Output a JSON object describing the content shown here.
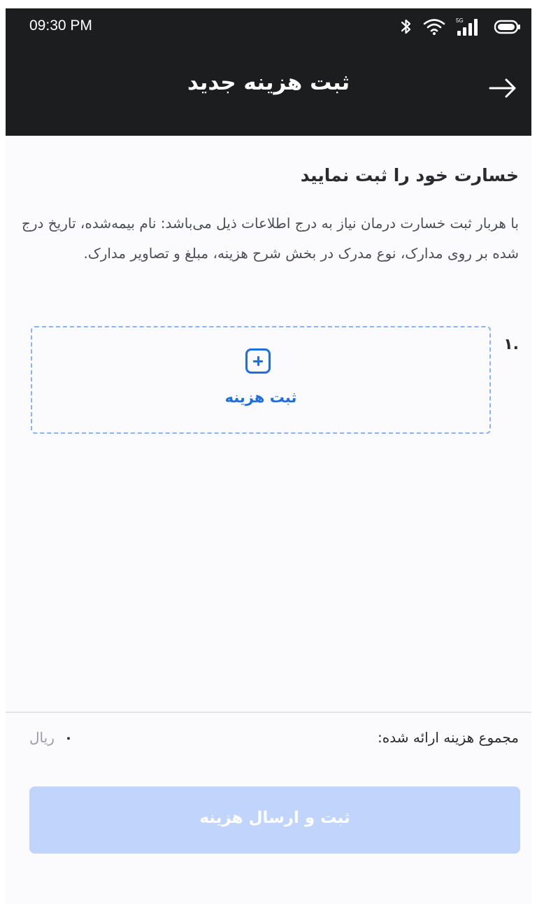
{
  "status_bar": {
    "time": "09:30 PM",
    "network_label": "5G",
    "icons": [
      "bluetooth-icon",
      "wifi-icon",
      "cellular-signal-icon",
      "battery-icon"
    ]
  },
  "app_bar": {
    "title": "ثبت هزینه جدید",
    "back_icon": "arrow-right-icon"
  },
  "intro": {
    "heading": "خسارت خود را ثبت نمایید",
    "description": "با هربار ثبت خسارت درمان نیاز به درج اطلاعات ذیل می‌باشد: نام بیمه‌شده، تاریخ درج شده بر روی مدارک، نوع مدرک در بخش شرح هزینه، مبلغ و تصاویر مدارک."
  },
  "expense_item": {
    "number": ".۱",
    "add_icon": "plus-square-icon",
    "add_label": "ثبت هزینه"
  },
  "summary": {
    "total_label": "مجموع هزینه ارائه شده:",
    "total_value": "۰",
    "currency": "ریال"
  },
  "submit": {
    "label": "ثبت و ارسال هزینه",
    "enabled": false
  },
  "colors": {
    "header_bg": "#1c1d1f",
    "accent": "#1f6fe0",
    "dashed_border": "#86b4f5",
    "button_disabled_bg": "#c1d4fb",
    "page_bg": "#fbfbfe"
  }
}
